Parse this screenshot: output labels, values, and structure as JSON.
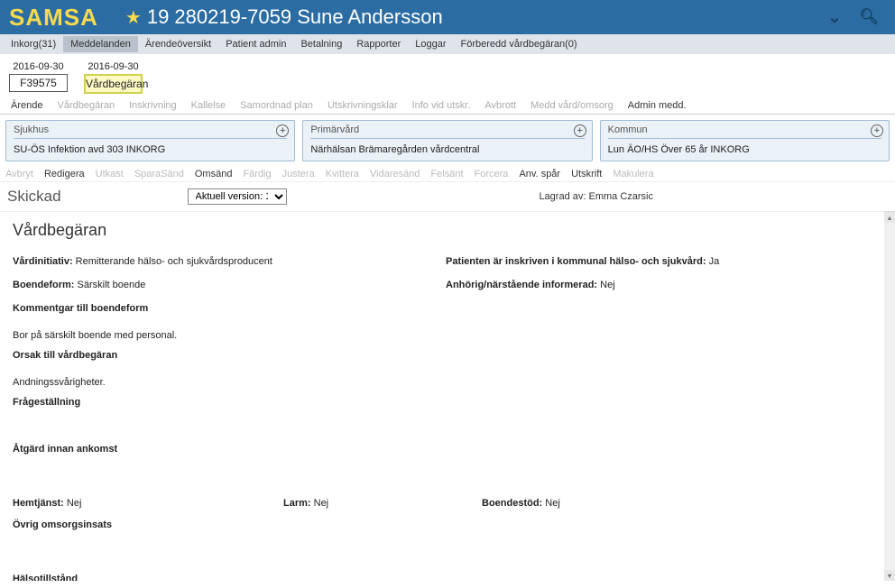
{
  "header": {
    "app_name": "SAMSA",
    "patient_id": "19 280219-7059 Sune Andersson"
  },
  "top_menu": {
    "items": [
      "Inkorg(31)",
      "Meddelanden",
      "Ärendeöversikt",
      "Patient admin",
      "Betalning",
      "Rapporter",
      "Loggar",
      "Förberedd vårdbegäran(0)"
    ],
    "active_index": 1
  },
  "doc_tabs": [
    {
      "date": "2016-09-30",
      "label": "F39575",
      "active": false
    },
    {
      "date": "2016-09-30",
      "label": "Vårdbegäran",
      "active": true
    }
  ],
  "sub_tabs": [
    {
      "label": "Ärende",
      "enabled": true
    },
    {
      "label": "Vårdbegäran",
      "enabled": false
    },
    {
      "label": "Inskrivning",
      "enabled": false
    },
    {
      "label": "Kallelse",
      "enabled": false
    },
    {
      "label": "Samordnad plan",
      "enabled": false
    },
    {
      "label": "Utskrivningsklar",
      "enabled": false
    },
    {
      "label": "Info vid utskr.",
      "enabled": false
    },
    {
      "label": "Avbrott",
      "enabled": false
    },
    {
      "label": "Medd vård/omsorg",
      "enabled": false
    },
    {
      "label": "Admin medd.",
      "enabled": true
    }
  ],
  "panels": {
    "hospital": {
      "title": "Sjukhus",
      "value": "SU-ÖS Infektion avd 303 INKORG"
    },
    "primary": {
      "title": "Primärvård",
      "value": "Närhälsan Brämaregården vårdcentral"
    },
    "municipal": {
      "title": "Kommun",
      "value": "Lun ÄO/HS Över 65 år INKORG"
    }
  },
  "actions": [
    {
      "label": "Avbryt",
      "enabled": false
    },
    {
      "label": "Redigera",
      "enabled": true
    },
    {
      "label": "Utkast",
      "enabled": false
    },
    {
      "label": "SparaSänd",
      "enabled": false
    },
    {
      "label": "Omsänd",
      "enabled": true
    },
    {
      "label": "Färdig",
      "enabled": false
    },
    {
      "label": "Justera",
      "enabled": false
    },
    {
      "label": "Kvittera",
      "enabled": false
    },
    {
      "label": "Vidaresänd",
      "enabled": false
    },
    {
      "label": "Felsänt",
      "enabled": false
    },
    {
      "label": "Forcera",
      "enabled": false
    },
    {
      "label": "Anv. spår",
      "enabled": true
    },
    {
      "label": "Utskrift",
      "enabled": true
    },
    {
      "label": "Makulera",
      "enabled": false
    }
  ],
  "status": {
    "title": "Skickad",
    "version_label": "Aktuell version: 1",
    "stored_by_label": "Lagrad av:",
    "stored_by_value": "Emma Czarsic"
  },
  "content": {
    "heading": "Vårdbegäran",
    "vardinitiativ_label": "Vårdinitiativ:",
    "vardinitiativ_value": " Remitterande hälso- och sjukvårdsproducent",
    "patient_enrolled_label": "Patienten är inskriven i kommunal hälso- och sjukvård:",
    "patient_enrolled_value": " Ja",
    "boendeform_label": "Boendeform:",
    "boendeform_value": " Särskilt boende",
    "anhorig_label": "Anhörig/närstående informerad:",
    "anhorig_value": " Nej",
    "kommentar_boende_label": "Kommentgar till boendeform",
    "kommentar_boende_text": "Bor på särskilt boende med personal.",
    "orsak_label": "Orsak till vårdbegäran",
    "orsak_text": "Andningssvårigheter.",
    "fragestallning_label": "Frågeställning",
    "atgard_label": "Åtgärd innan ankomst",
    "hemtjanst_label": "Hemtjänst:",
    "hemtjanst_value": " Nej",
    "larm_label": "Larm:",
    "larm_value": " Nej",
    "boendestod_label": "Boendestöd:",
    "boendestod_value": " Nej",
    "ovrig_label": "Övrig omsorgsinsats",
    "halsotillstand_label": "Hälsotillstånd"
  }
}
